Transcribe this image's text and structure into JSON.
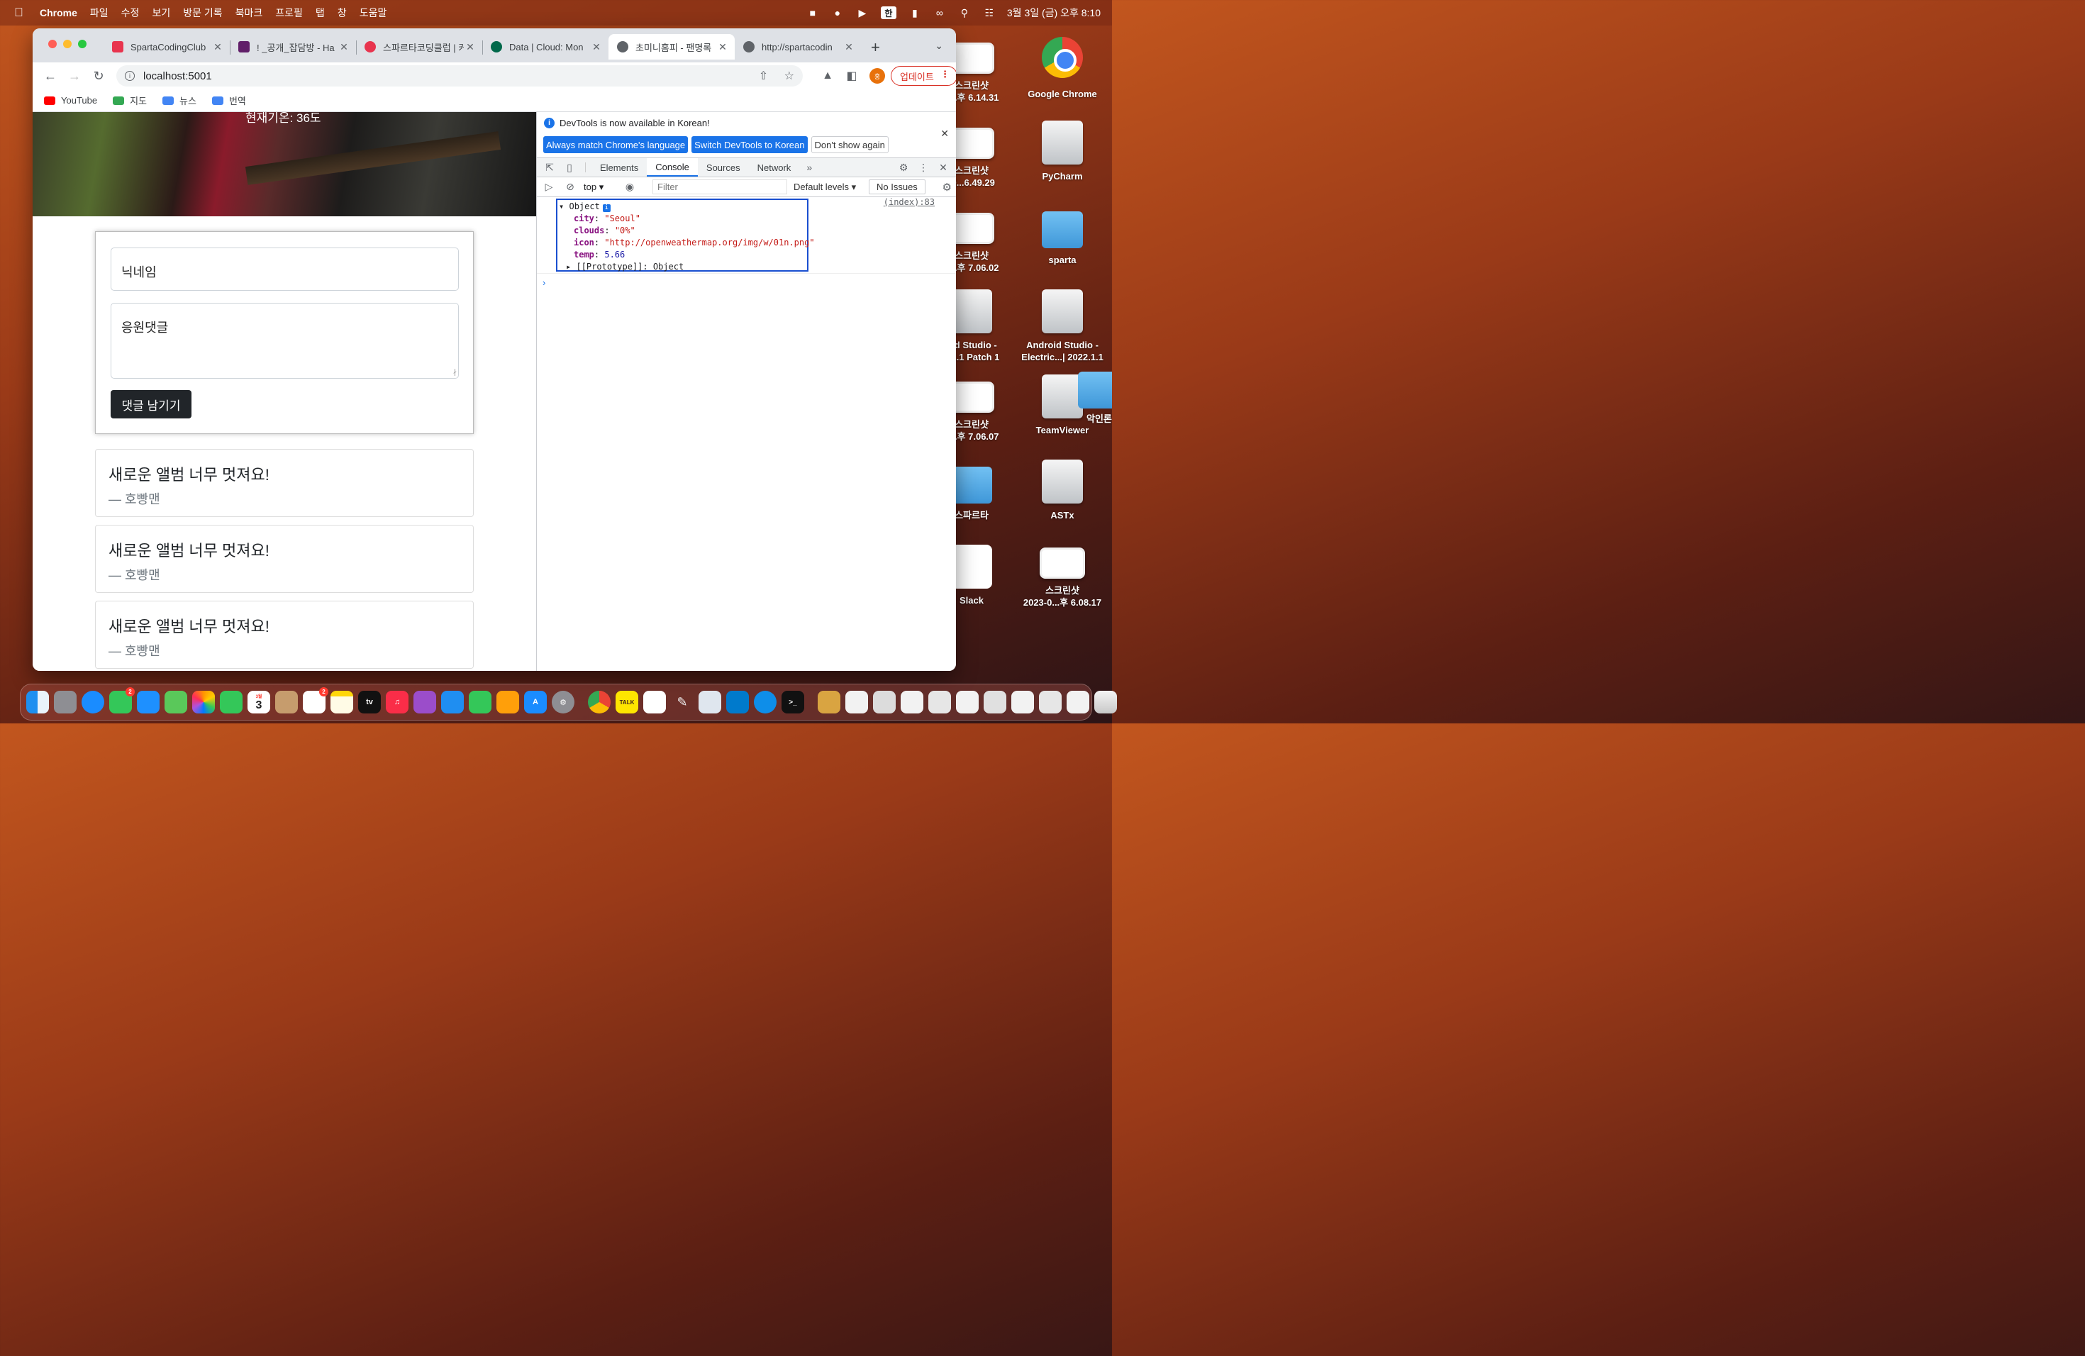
{
  "menubar": {
    "app_name": "Chrome",
    "menus": [
      "파일",
      "수정",
      "보기",
      "방문 기록",
      "북마크",
      "프로필",
      "탭",
      "창",
      "도움말"
    ],
    "input_source": "한",
    "clock": "3월 3일 (금) 오후 8:10"
  },
  "browser": {
    "tabs": [
      {
        "title": "SpartaCodingClub",
        "favicon_color": "#e8344e",
        "active": false
      },
      {
        "title": "! _공개_잡담방 - Ha",
        "favicon_color": "#611f69",
        "active": false
      },
      {
        "title": "스파르타코딩클럽 | 커",
        "favicon_color": "#e8344e",
        "active": false
      },
      {
        "title": "Data | Cloud: Mon",
        "favicon_color": "#00684a",
        "active": false
      },
      {
        "title": "초미니홈피 - 팬명록",
        "favicon_color": "#5f6368",
        "active": true
      },
      {
        "title": "http://spartacodin",
        "favicon_color": "#5f6368",
        "active": false
      }
    ],
    "url": "localhost:5001",
    "update_label": "업데이트",
    "profile_initial": "홍",
    "bookmarks": [
      {
        "label": "YouTube",
        "color": "#ff0000"
      },
      {
        "label": "지도",
        "color": "#34a853"
      },
      {
        "label": "뉴스",
        "color": "#4285f4"
      },
      {
        "label": "번역",
        "color": "#4285f4"
      }
    ]
  },
  "page": {
    "temperature_text": "현재기온: 36도",
    "nickname_placeholder": "닉네임",
    "comment_placeholder": "응원댓글",
    "submit_label": "댓글 남기기",
    "comments": [
      {
        "message": "새로운 앨범 너무 멋져요!",
        "author": "— 호빵맨"
      },
      {
        "message": "새로운 앨범 너무 멋져요!",
        "author": "— 호빵맨"
      },
      {
        "message": "새로운 앨범 너무 멋져요!",
        "author": "— 호빵맨"
      }
    ]
  },
  "devtools": {
    "banner_text": "DevTools is now available in Korean!",
    "btn_match": "Always match Chrome's language",
    "btn_switch": "Switch DevTools to Korean",
    "btn_dont_show": "Don't show again",
    "tabs": [
      "Elements",
      "Console",
      "Sources",
      "Network"
    ],
    "active_tab": "Console",
    "context": "top",
    "filter_placeholder": "Filter",
    "levels": "Default levels",
    "issues": "No Issues",
    "log": {
      "source": "(index):83",
      "type": "Object",
      "props": [
        {
          "key": "city",
          "value": "\"Seoul\"",
          "kind": "str"
        },
        {
          "key": "clouds",
          "value": "\"0%\"",
          "kind": "str"
        },
        {
          "key": "icon",
          "value": "\"http://openweathermap.org/img/w/01n.png\"",
          "kind": "str"
        },
        {
          "key": "temp",
          "value": "5.66",
          "kind": "num"
        }
      ],
      "prototype": "[[Prototype]]: Object"
    }
  },
  "desktop": {
    "icons_left": [
      {
        "label": "스크린샷\n0...후 6.14.31"
      },
      {
        "label": "스크린샷\n-0...6.49.29"
      },
      {
        "label": "스크린샷\n0...후 7.06.02"
      },
      {
        "label": "oid Studio -\nc....1 Patch 1"
      },
      {
        "label": "스크린샷\n0...후 7.06.07"
      },
      {
        "label": "스파르타"
      },
      {
        "label": "Slack"
      }
    ],
    "icons_right": [
      {
        "label": "Google Chrome"
      },
      {
        "label": "PyCharm"
      },
      {
        "label": "sparta"
      },
      {
        "label": "Android Studio -\nElectric...| 2022.1.1"
      },
      {
        "label": "TeamViewer"
      },
      {
        "label": "ASTx"
      },
      {
        "label": "스크린샷\n2023-0...후 6.08.17"
      }
    ],
    "partial_label": "악인론"
  },
  "dock": {
    "apps": [
      "finder",
      "launchpad",
      "safari",
      "messages",
      "mail",
      "maps",
      "photos",
      "facetime",
      "calendar",
      "contacts",
      "reminders",
      "notes",
      "tv",
      "music",
      "podcasts",
      "keynote",
      "numbers",
      "pages",
      "app-store",
      "system-settings",
      "chrome",
      "kakaotalk",
      "slack",
      "pen",
      "preview",
      "vscode",
      "teamviewer",
      "terminal"
    ],
    "calendar_day": "3",
    "calendar_month": "3월",
    "messages_badge": "2",
    "reminders_badge": "2",
    "kakao_label": "TALK",
    "tv_label": "tv"
  }
}
